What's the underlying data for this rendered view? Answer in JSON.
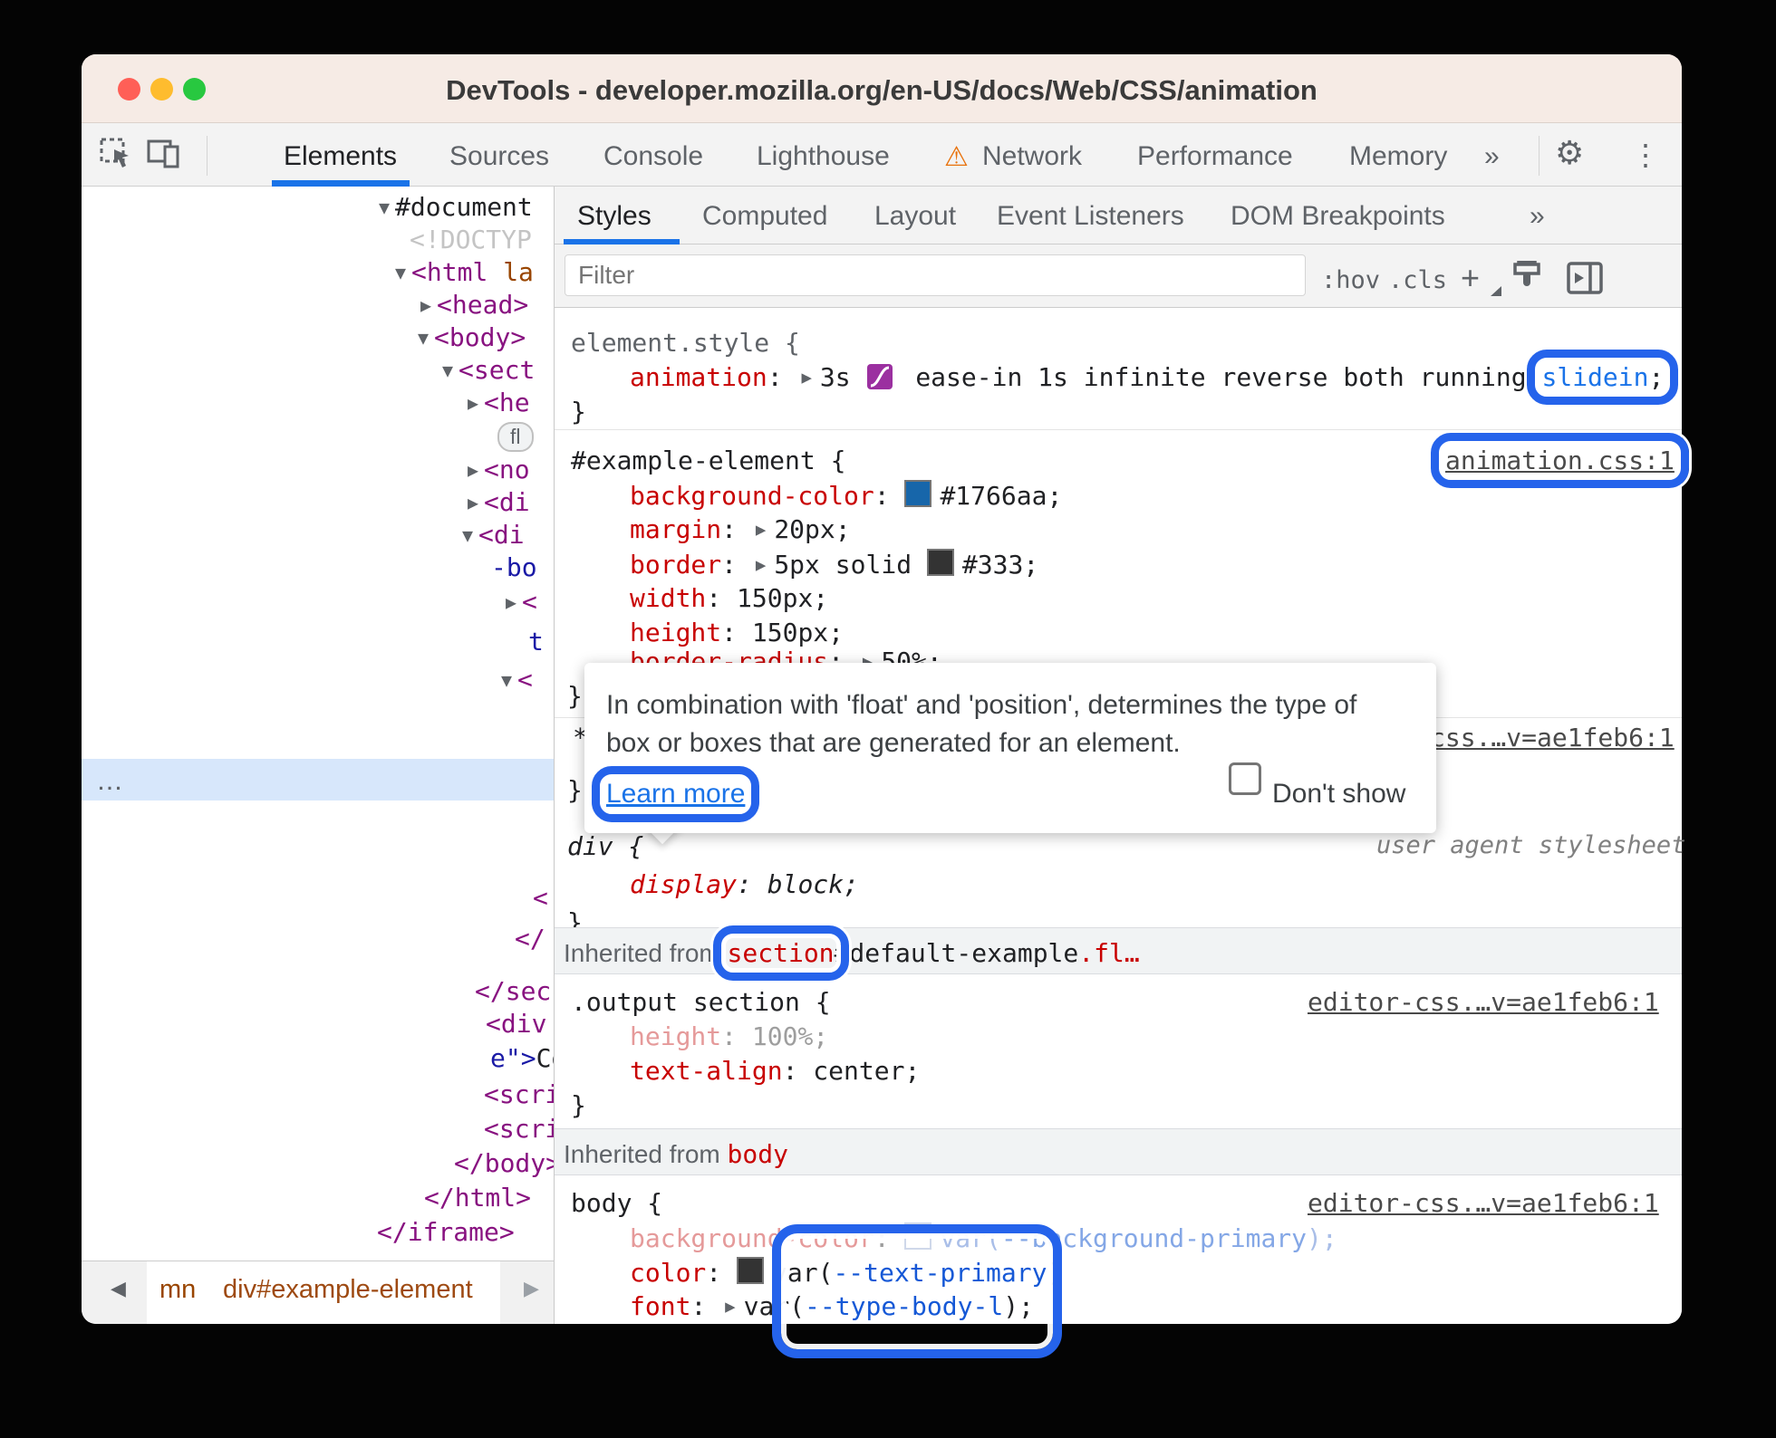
{
  "titlebar": {
    "title": "DevTools - developer.mozilla.org/en-US/docs/Web/CSS/animation"
  },
  "toolbar": {
    "tabs": [
      "Elements",
      "Sources",
      "Console",
      "Lighthouse",
      "Network",
      "Performance",
      "Memory"
    ],
    "more": "»"
  },
  "panel_tabs": {
    "tabs": [
      "Styles",
      "Computed",
      "Layout",
      "Event Listeners",
      "DOM Breakpoints"
    ],
    "more": "»"
  },
  "filter": {
    "placeholder": "Filter",
    "hov": ":hov",
    "cls": ".cls",
    "plus": "+"
  },
  "icons": {
    "collapse": "▼",
    "expand": "▶",
    "back": "◀",
    "forward": "▶",
    "warning": "⚠",
    "gear": "⚙",
    "kebab": "⋮",
    "dots": "…"
  },
  "dom": {
    "rows": [
      {
        "a": "▼",
        "t": "#document"
      },
      {
        "t": "<!DOCTYP"
      },
      {
        "a": "▼",
        "t": "<html",
        "t2": " la"
      },
      {
        "a": "▶",
        "t": "<head>"
      },
      {
        "a": "▼",
        "t": "<body>"
      },
      {
        "a": "▼",
        "t": "<sect"
      },
      {
        "a": "▶",
        "t": "<he"
      },
      {
        "pill": "fl"
      },
      {
        "a": "▶",
        "t": "<no"
      },
      {
        "a": "▶",
        "t": "<di"
      },
      {
        "a": "▼",
        "t": "<di"
      },
      {
        "t": "-bo"
      },
      {
        "a": "▶",
        "t": "<"
      },
      {
        "t": "t"
      },
      {
        "a": "▼",
        "t": "<"
      },
      {
        "t": "<"
      },
      {
        "t": "</"
      },
      {
        "t": "</sec"
      },
      {
        "t": "<div"
      },
      {
        "t": "e\">",
        "t2": "Co"
      },
      {
        "t": "<scri"
      },
      {
        "t": "<scri"
      },
      {
        "t": "</body>"
      },
      {
        "t": "</html>"
      },
      {
        "t": "</iframe>"
      }
    ]
  },
  "breadcrumb": {
    "back": "◀",
    "crumb_truncated": "mn",
    "crumb_selected": "div#example-element",
    "forward": "▶"
  },
  "styles": {
    "punct": {
      "cs": ": ",
      "close": "}",
      "star": "*"
    },
    "element_style": {
      "selector": "element.style {",
      "prop": "animation",
      "v1": "3s ",
      "v2": " ease-in 1s infinite reverse both running ",
      "name": "slidein",
      "semi": ";",
      "close": "}"
    },
    "example": {
      "selector": "#example-element {",
      "link": "animation.css:1",
      "close": "}",
      "lines": [
        {
          "p": "background-color",
          "v": "#1766aa;",
          "swatch": "#1766aa"
        },
        {
          "p": "margin",
          "v": "20px;"
        },
        {
          "p": "border",
          "v1": "5px solid ",
          "v2": "#333;",
          "swatch": "#333"
        },
        {
          "p": "width",
          "v": "150px;"
        },
        {
          "p": "height",
          "v": "150px;"
        },
        {
          "p": "border-radius",
          "v": "50%;"
        }
      ]
    },
    "fragments": {
      "close1": "}",
      "star": "*",
      "link": "css.…v=ae1feb6:1",
      "close2": "}"
    },
    "ua_rule": {
      "selector": "div {",
      "origin": "user agent stylesheet",
      "p": "display",
      "v": "block;",
      "close": "}"
    },
    "inherited_section": {
      "label": "Inherited from ",
      "tag": "section",
      "id": "#default-example",
      "cls": ".fl…"
    },
    "output_rule": {
      "selector": ".output section {",
      "link": "editor-css.…v=ae1feb6:1",
      "lines": [
        {
          "p": "height",
          "v": "100%;"
        },
        {
          "p": "text-align",
          "v": "center;"
        }
      ],
      "close": "}"
    },
    "inherited_body": {
      "label": "Inherited from ",
      "tag": "body"
    },
    "body_rule": {
      "selector": "body {",
      "link": "editor-css.…v=ae1feb6:1",
      "bg": {
        "p": "background-color",
        "f": "var(",
        "name": "--background-primary",
        "e": ");"
      },
      "color": {
        "p": "color",
        "f": "var(",
        "name": "--text-primary",
        "e": ")"
      },
      "font": {
        "p": "font",
        "f": "var(",
        "name": "--type-body-l",
        "e": ");"
      }
    }
  },
  "tooltip": {
    "line1": "In combination with 'float' and 'position', determines the type of",
    "line2": "box or boxes that are generated for an element.",
    "learn_more": "Learn more",
    "dont_show": "Don't show"
  },
  "colors": {
    "accent": "#1a73e8",
    "annotation": "#2563eb",
    "swatch_background": "#1766aa",
    "swatch_border": "#333"
  }
}
